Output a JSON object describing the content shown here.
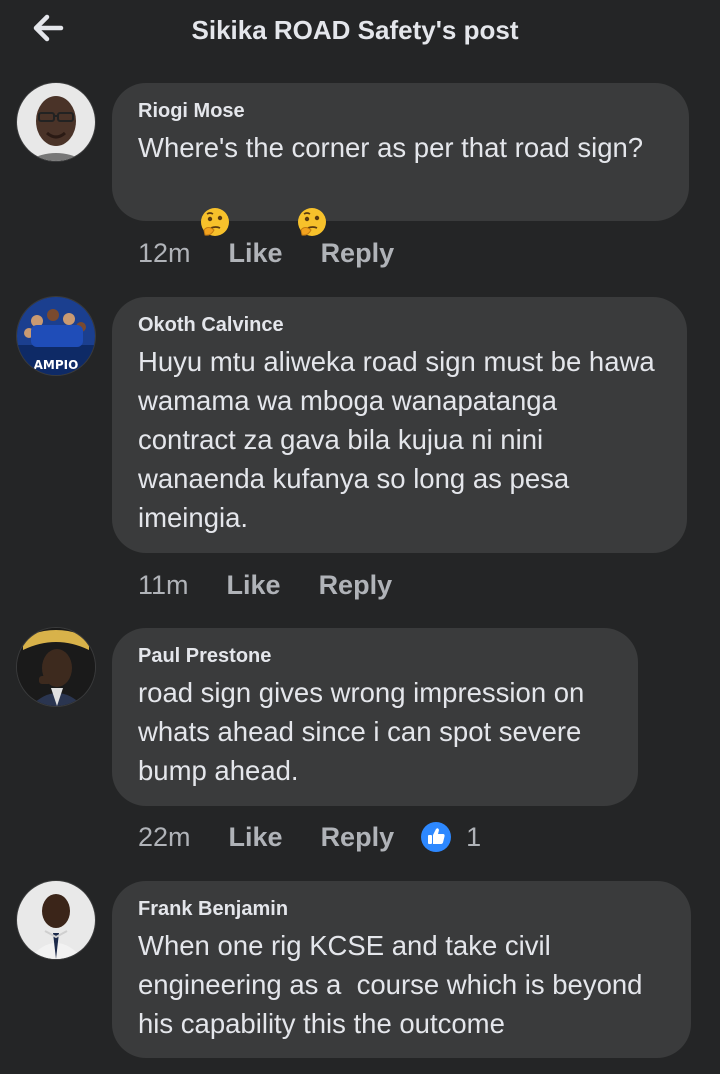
{
  "header": {
    "back_icon": "arrow-left-icon",
    "title": "Sikika ROAD Safety's post"
  },
  "comments": [
    {
      "author": "Riogi Mose",
      "text": "Where's the corner as per that road sign?",
      "emojis": [
        "thinking-face-icon",
        "thinking-face-icon"
      ],
      "time": "12m",
      "like_label": "Like",
      "reply_label": "Reply"
    },
    {
      "author": "Okoth Calvince",
      "text": "Huyu mtu aliweka road sign must be hawa wamama wa mboga wanapatanga contract za gava bila kujua ni nini wanaenda kufanya so long as pesa imeingia.",
      "time": "11m",
      "like_label": "Like",
      "reply_label": "Reply",
      "avatar_text": "AMPIO"
    },
    {
      "author": "Paul Prestone",
      "text": "road sign gives wrong impression on whats ahead since i can spot severe bump ahead.",
      "time": "22m",
      "like_label": "Like",
      "reply_label": "Reply",
      "reaction_icon": "thumbs-up-icon",
      "reaction_count": "1"
    },
    {
      "author": "Frank Benjamin",
      "text": "When one rig KCSE and take civil engineering as a  course which is beyond his capability this the outcome"
    }
  ],
  "colors": {
    "background": "#242526",
    "bubble": "#3a3b3c",
    "text": "#e4e6eb",
    "secondary": "#b0b3b8",
    "like_blue": "#2d88ff"
  }
}
